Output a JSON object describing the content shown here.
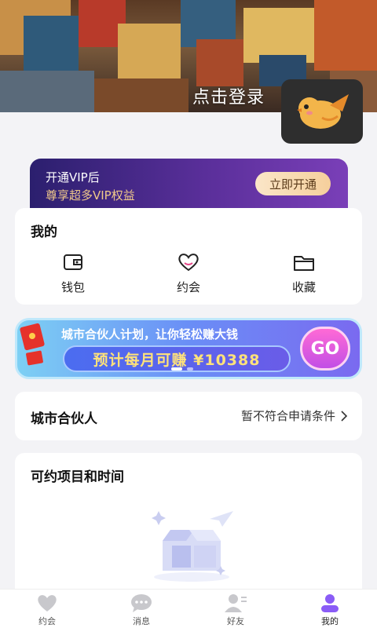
{
  "header": {
    "login_label": "点击登录",
    "avatar_icon": "bird-logo-icon"
  },
  "vip": {
    "line1": "开通VIP后",
    "line2": "尊享超多VIP权益",
    "button": "立即开通"
  },
  "mine": {
    "title": "我的",
    "items": [
      {
        "label": "钱包",
        "icon": "wallet-icon"
      },
      {
        "label": "约会",
        "icon": "heart-icon"
      },
      {
        "label": "收藏",
        "icon": "folder-icon"
      }
    ]
  },
  "banner": {
    "line1": "城市合伙人计划，让你轻松赚大钱",
    "line2": "预计每月可赚 ¥10388",
    "go": "GO"
  },
  "partner": {
    "title": "城市合伙人",
    "status": "暂不符合申请条件"
  },
  "schedule": {
    "title": "可约项目和时间",
    "empty_icon": "empty-box-icon"
  },
  "tabbar": {
    "tabs": [
      {
        "label": "约会",
        "icon": "heart-icon",
        "active": false
      },
      {
        "label": "消息",
        "icon": "message-icon",
        "active": false
      },
      {
        "label": "好友",
        "icon": "contacts-icon",
        "active": false
      },
      {
        "label": "我的",
        "icon": "user-icon",
        "active": true
      }
    ]
  },
  "colors": {
    "accent": "#8a5cf6",
    "inactive_icon": "#c8c8cc"
  }
}
